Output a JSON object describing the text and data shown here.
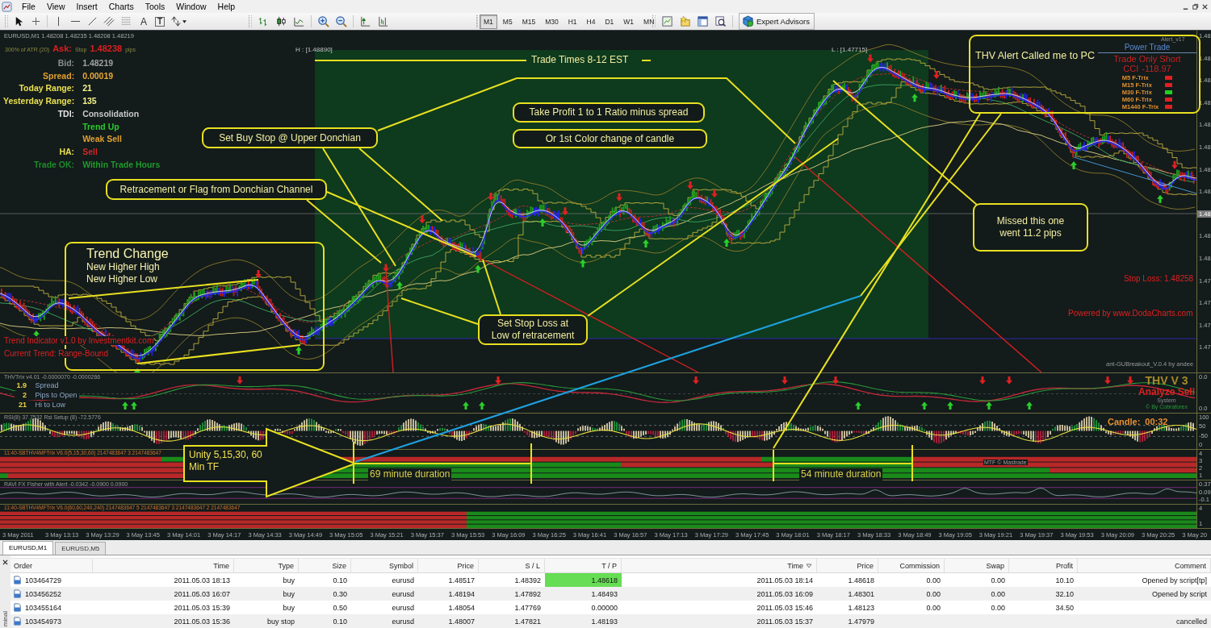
{
  "menu_bar": {
    "items": [
      "File",
      "View",
      "Insert",
      "Charts",
      "Tools",
      "Window",
      "Help"
    ]
  },
  "toolbar": {
    "text_tools": [
      "A",
      "T"
    ],
    "timeframes": [
      {
        "label": "M1",
        "selected": true
      },
      {
        "label": "M5",
        "selected": false
      },
      {
        "label": "M15",
        "selected": false
      },
      {
        "label": "M30",
        "selected": false
      },
      {
        "label": "H1",
        "selected": false
      },
      {
        "label": "H4",
        "selected": false
      },
      {
        "label": "D1",
        "selected": false
      },
      {
        "label": "W1",
        "selected": false
      },
      {
        "label": "MN",
        "selected": false
      }
    ],
    "expert_advisors": "Expert Advisors"
  },
  "chart": {
    "header": "EURUSD,M1 1.48208 1.48235 1.48208 1.48219",
    "atr_label": "300% of ATR (20)",
    "ask_label": "Ask:",
    "stop_label": "Stop",
    "ask_value": "1.48238",
    "stop_unit": "pips",
    "info": [
      {
        "label": {
          "text": "Bid:",
          "color": "#8c8c8c"
        },
        "value": {
          "text": "1.48219",
          "color": "#a0a0a0"
        }
      },
      {
        "label": {
          "text": "Spread:",
          "color": "#e0a030"
        },
        "value": {
          "text": "0.00019",
          "color": "#e8a838"
        }
      },
      {
        "label": {
          "text": "Today Range:",
          "color": "#e8e050"
        },
        "value": {
          "text": "21",
          "color": "#f2f28a"
        }
      },
      {
        "label": {
          "text": "Yesterday Range:",
          "color": "#e8e050"
        },
        "value": {
          "text": "135",
          "color": "#f2f28a"
        }
      },
      {
        "label": {
          "text": "TDI:",
          "color": "#e8e8e8"
        },
        "value": {
          "text": "Consolidation",
          "color": "#c8c8c8"
        }
      },
      {
        "value": {
          "text": "Trend Up",
          "color": "#2cc82c"
        }
      },
      {
        "value": {
          "text": "Weak Sell",
          "color": "#e0a030"
        }
      },
      {
        "label": {
          "text": "HA:",
          "color": "#e8e050"
        },
        "value": {
          "text": "Sell",
          "color": "#d02828"
        }
      },
      {
        "label": {
          "text": "Trade OK:",
          "color": "#1f8a2a"
        },
        "value": {
          "text": "Within Trade Hours",
          "color": "#1f9a2a"
        }
      }
    ],
    "high_label": "H : [1.48890]",
    "low_label": "L : [1.47715]",
    "alert_label": "Alert_v17",
    "power_trade": {
      "title": "Power Trade",
      "signal": "Trade Only Short",
      "cci_label": "CCI",
      "cci_value": "-118.97",
      "f_trix": [
        {
          "label": "M5 F-Trix",
          "color": "#e02020"
        },
        {
          "label": "M15 F-Trix",
          "color": "#e02020"
        },
        {
          "label": "M30 F-Trix",
          "color": "#20d020"
        },
        {
          "label": "M60 F-Trix",
          "color": "#e02020"
        },
        {
          "label": "M1440 F-Trix",
          "color": "#e02020"
        }
      ]
    },
    "stop_loss": "Stop Loss: 1.48258",
    "powered_by": "Powered by www.DodaCharts.com",
    "breakout_label": "ant-GUBreakout_V.0.4 by andee",
    "trend_indicator": "Trend Indicator v1.0 by Investmentkit.com",
    "current_trend": "Current Trend: Range-Bound",
    "price_axis": [
      {
        "text": "1.48",
        "current": false
      },
      {
        "text": "1.48",
        "current": false
      },
      {
        "text": "1.48",
        "current": false
      },
      {
        "text": "1.48",
        "current": false
      },
      {
        "text": "1.48",
        "current": false
      },
      {
        "text": "1.48",
        "current": false
      },
      {
        "text": "1.48",
        "current": false
      },
      {
        "text": "1.48",
        "current": false
      },
      {
        "text": "1.48",
        "current": true
      },
      {
        "text": "1.48",
        "current": false
      },
      {
        "text": "1.48",
        "current": false
      },
      {
        "text": "1.47",
        "current": false
      },
      {
        "text": "1.47",
        "current": false
      },
      {
        "text": "1.47",
        "current": false
      },
      {
        "text": "1.47",
        "current": false
      }
    ]
  },
  "thv_pane": {
    "title": "THVTrix v4.01 -0.0000070 -0.0000266",
    "stats": [
      "**1.9** Spread",
      "**2** Pips to Open",
      "**21** Hi to Low"
    ],
    "brand": "THV V 3",
    "signal": "Analyze Sell",
    "system": "System",
    "credit": "© By Cobraforex",
    "axis": [
      "0.0",
      "0.0"
    ]
  },
  "rsi_pane": {
    "title": "RSI(8) 37.7532 Rsi Setup (8) -72.5776",
    "candle_label": "Candle:",
    "candle_time": "00:32",
    "axis": [
      "100",
      "50",
      "-50",
      "0"
    ]
  },
  "mtf_pane": {
    "title": "11:40-SBTHV4MFTrix V6.0(5,15,30,60) 2147483647 3 2147483647",
    "credit": "MTF © Mastrade",
    "axis": [
      "4",
      "3",
      "2",
      "1"
    ]
  },
  "ravi_pane": {
    "title": "RAVI FX Fisher with Alert -0.0342 -0.0900 0.0900",
    "axis": [
      "0.37",
      "0.09",
      "-0.1"
    ]
  },
  "mtf_long_pane": {
    "title": "11:40-SBTHV4MFTrix V6.0(60,60,240,240) 2147483647 5 2147483647 3 2147483647 2 2147483647",
    "axis": [
      "4",
      "1"
    ]
  },
  "time_axis": [
    "3 May 2011",
    "3 May 13:13",
    "3 May 13:29",
    "3 May 13:45",
    "3 May 14:01",
    "3 May 14:17",
    "3 May 14:33",
    "3 May 14:49",
    "3 May 15:05",
    "3 May 15:21",
    "3 May 15:37",
    "3 May 15:53",
    "3 May 16:09",
    "3 May 16:25",
    "3 May 16:41",
    "3 May 16:57",
    "3 May 17:13",
    "3 May 17:29",
    "3 May 17:45",
    "3 May 18:01",
    "3 May 18:17",
    "3 May 18:33",
    "3 May 18:49",
    "3 May 19:05",
    "3 May 19:21",
    "3 May 19:37",
    "3 May 19:53",
    "3 May 20:09",
    "3 May 20:25",
    "3 May 20"
  ],
  "annotations": [
    {
      "kind": "banner",
      "lines": [
        "Trade Times 8-12 EST"
      ]
    },
    {
      "kind": "frame",
      "lines": [
        "THV Alert Called me to PC"
      ]
    },
    {
      "kind": "callout",
      "lines": [
        "Take Profit 1 to 1 Ratio minus spread"
      ]
    },
    {
      "kind": "callout",
      "lines": [
        "Set Buy Stop @ Upper Donchian"
      ]
    },
    {
      "kind": "callout",
      "lines": [
        "Or 1st Color change of candle"
      ]
    },
    {
      "kind": "callout",
      "lines": [
        "Retracement or Flag from Donchian Channel"
      ]
    },
    {
      "kind": "callout",
      "lines": [
        "Missed this one",
        "went 11.2 pips"
      ]
    },
    {
      "kind": "panel",
      "title": "Trend Change",
      "lines": [
        "New Higher High",
        "New Higher Low"
      ]
    },
    {
      "kind": "callout",
      "lines": [
        "Set Stop Loss at",
        "Low of retracement"
      ]
    },
    {
      "kind": "arrow",
      "lines": [
        "Unity 5,15,30, 60",
        "Min TF"
      ]
    },
    {
      "kind": "duration",
      "lines": [
        "69 minute duration"
      ]
    },
    {
      "kind": "duration",
      "lines": [
        "54 minute duration"
      ]
    }
  ],
  "chart_tabs": [
    {
      "label": "EURUSD,M1",
      "selected": true
    },
    {
      "label": "EURUSD,M5",
      "selected": false
    }
  ],
  "terminal": {
    "side_label": "minal",
    "columns": [
      {
        "label": "Order",
        "sorted": false
      },
      {
        "label": "Time",
        "sorted": false
      },
      {
        "label": "Type",
        "sorted": false
      },
      {
        "label": "Size",
        "sorted": false
      },
      {
        "label": "Symbol",
        "sorted": false
      },
      {
        "label": "Price",
        "sorted": false
      },
      {
        "label": "S / L",
        "sorted": false
      },
      {
        "label": "T / P",
        "sorted": false
      },
      {
        "label": "Time",
        "sorted": true
      },
      {
        "label": "Price",
        "sorted": false
      },
      {
        "label": "Commission",
        "sorted": false
      },
      {
        "label": "Swap",
        "sorted": false
      },
      {
        "label": "Profit",
        "sorted": false
      },
      {
        "label": "Comment",
        "sorted": false
      }
    ],
    "rows": [
      {
        "order": "103464729",
        "open_time": "2011.05.03 18:13",
        "type": "buy",
        "size": "0.10",
        "symbol": "eurusd",
        "price": "1.48517",
        "sl": "1.48392",
        "tp": "1.48618",
        "close_time": "2011.05.03 18:14",
        "close_price": "1.48618",
        "commission": "0.00",
        "swap": "0.00",
        "profit": "10.10",
        "comment": "Opened by script[tp]",
        "tp_hit": true
      },
      {
        "order": "103456252",
        "open_time": "2011.05.03 16:07",
        "type": "buy",
        "size": "0.30",
        "symbol": "eurusd",
        "price": "1.48194",
        "sl": "1.47892",
        "tp": "1.48493",
        "close_time": "2011.05.03 16:09",
        "close_price": "1.48301",
        "commission": "0.00",
        "swap": "0.00",
        "profit": "32.10",
        "comment": "Opened by script",
        "tp_hit": false
      },
      {
        "order": "103455164",
        "open_time": "2011.05.03 15:39",
        "type": "buy",
        "size": "0.50",
        "symbol": "eurusd",
        "price": "1.48054",
        "sl": "1.47769",
        "tp": "0.00000",
        "close_time": "2011.05.03 15:46",
        "close_price": "1.48123",
        "commission": "0.00",
        "swap": "0.00",
        "profit": "34.50",
        "tp_hit": false
      },
      {
        "order": "103454973",
        "open_time": "2011.05.03 15:36",
        "type": "buy stop",
        "size": "0.10",
        "symbol": "eurusd",
        "price": "1.48007",
        "sl": "1.47821",
        "tp": "1.48193",
        "close_time": "2011.05.03 15:37",
        "close_price": "1.47979",
        "comment": "cancelled",
        "tp_hit": false
      }
    ]
  }
}
